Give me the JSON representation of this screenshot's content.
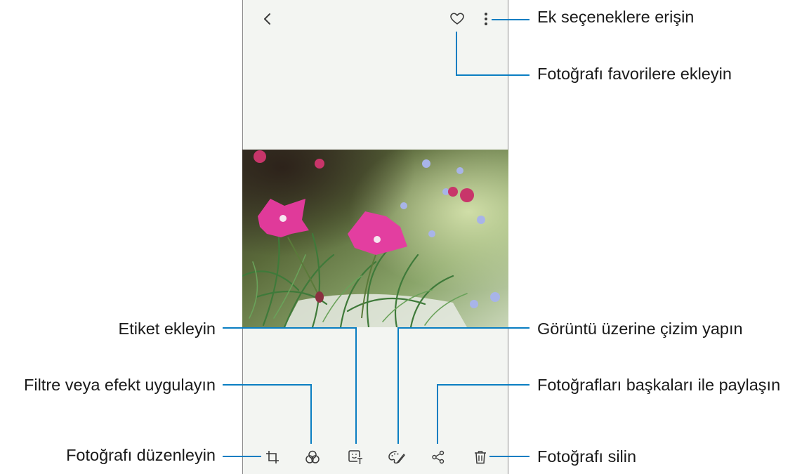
{
  "screen": {
    "top_bar": {
      "back_icon": "chevron-left-icon",
      "favorite_icon": "heart-outline-icon",
      "more_icon": "vertical-dots-icon"
    },
    "photo": {
      "subject": "pink carnation flowers"
    },
    "bottom_bar": {
      "items": [
        {
          "icon": "crop-icon"
        },
        {
          "icon": "filter-circles-icon"
        },
        {
          "icon": "sticker-text-icon"
        },
        {
          "icon": "palette-draw-icon"
        },
        {
          "icon": "share-icon"
        },
        {
          "icon": "trash-icon"
        }
      ]
    }
  },
  "callouts": {
    "more_options": "Ek seçeneklere erişin",
    "favorite": "Fotoğrafı favorilere ekleyin",
    "add_sticker": "Etiket ekleyin",
    "draw": "Görüntü üzerine çizim yapın",
    "filter": "Filtre veya efekt uygulayın",
    "share": "Fotoğrafları başkaları ile paylaşın",
    "edit": "Fotoğrafı düzenleyin",
    "delete": "Fotoğrafı silin"
  },
  "colors": {
    "callout_line": "#0a7ec2",
    "icon": "#3a3a3a",
    "screen_bg": "#f3f5f2"
  }
}
